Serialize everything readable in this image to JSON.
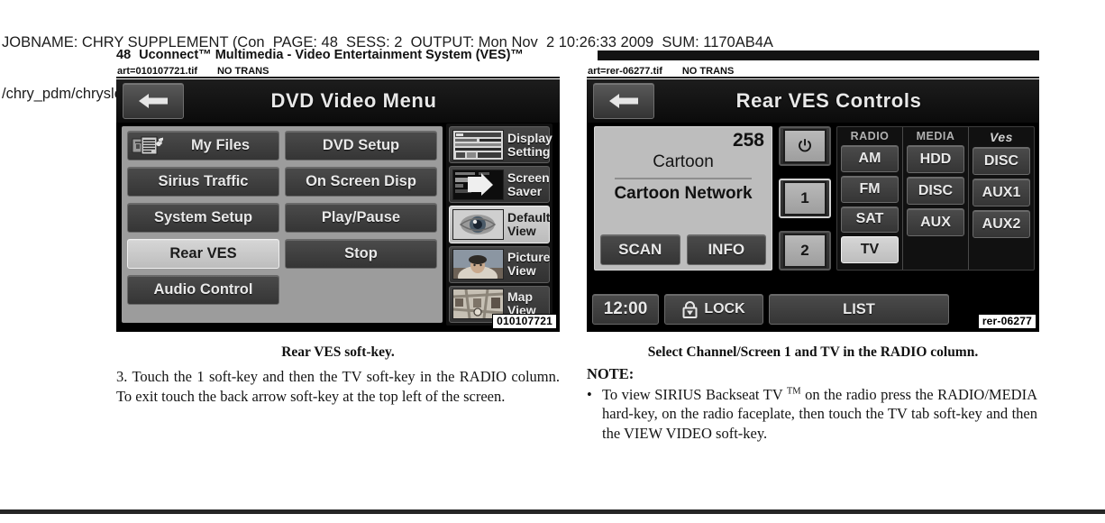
{
  "job_header": {
    "line1": "JOBNAME: CHRY SUPPLEMENT (Con  PAGE: 48  SESS: 2  OUTPUT: Mon Nov  2 10:26:33 2009  SUM: 1170AB4A",
    "line2": "/chry_pdm/chrysler/supplement/uct/su"
  },
  "running_head": {
    "page_number": "48",
    "title": "Uconnect™ Multimedia - Video Entertainment System (VES)™"
  },
  "art_tags": {
    "left": {
      "file": "art=010107721.tif",
      "trans": "NO TRANS"
    },
    "right": {
      "file": "art=rer-06277.tif",
      "trans": "NO TRANS"
    }
  },
  "figures": {
    "left": {
      "art_id": "010107721",
      "caption": "Rear VES soft-key.",
      "screen": {
        "title": "DVD Video Menu",
        "back_icon": "back-arrow-icon",
        "left_column": [
          {
            "label": "My Files",
            "icon": "media-files-icon",
            "selected": false
          },
          {
            "label": "Sirius Traffic",
            "selected": false
          },
          {
            "label": "System Setup",
            "selected": false
          },
          {
            "label": "Rear  VES",
            "selected": true
          },
          {
            "label": "Audio Control",
            "selected": false
          }
        ],
        "right_column": [
          {
            "label": "DVD Setup",
            "selected": false
          },
          {
            "label": "On  Screen  Disp",
            "selected": false
          },
          {
            "label": "Play/Pause",
            "selected": false
          },
          {
            "label": "Stop",
            "selected": false
          },
          {
            "label": "",
            "selected": false,
            "blank": true
          }
        ],
        "view_column": [
          {
            "label": "Display\nSetting",
            "icon": "display-setting-thumb",
            "selected": false
          },
          {
            "label": "Screen\nSaver",
            "icon": "screen-saver-thumb",
            "selected": false
          },
          {
            "label": "Default\nView",
            "icon": "default-view-thumb",
            "selected": true
          },
          {
            "label": "Picture\nView",
            "icon": "picture-view-thumb",
            "selected": false
          },
          {
            "label": "Map\nView",
            "icon": "map-view-thumb",
            "selected": false
          }
        ]
      }
    },
    "right": {
      "art_id": "rer-06277",
      "caption": "Select Channel/Screen 1 and TV in the RADIO column.",
      "screen": {
        "title": "Rear VES Controls",
        "back_icon": "back-arrow-icon",
        "info": {
          "channel_number": "258",
          "channel_name": "Cartoon",
          "channel_detail": "Cartoon Network",
          "scan_label": "SCAN",
          "info_label": "INFO"
        },
        "screen_select": [
          {
            "label": "⏻",
            "name": "power-button",
            "selected": false
          },
          {
            "label": "1",
            "name": "screen-1-button",
            "selected": true
          },
          {
            "label": "2",
            "name": "screen-2-button",
            "selected": false
          }
        ],
        "source_columns": [
          {
            "header": "RADIO",
            "buttons": [
              {
                "label": "AM",
                "selected": false
              },
              {
                "label": "FM",
                "selected": false
              },
              {
                "label": "SAT",
                "selected": false
              },
              {
                "label": "TV",
                "selected": true
              }
            ]
          },
          {
            "header": "MEDIA",
            "buttons": [
              {
                "label": "HDD",
                "selected": false
              },
              {
                "label": "DISC",
                "selected": false
              },
              {
                "label": "AUX",
                "selected": false
              }
            ]
          },
          {
            "header": "Ves",
            "buttons": [
              {
                "label": "DISC",
                "selected": false
              },
              {
                "label": "AUX1",
                "selected": false
              },
              {
                "label": "AUX2",
                "selected": false
              }
            ]
          }
        ],
        "bottom_bar": {
          "clock": "12:00",
          "lock_label": "LOCK",
          "lock_icon": "lock-icon",
          "list_label": "LIST"
        }
      }
    }
  },
  "body": {
    "left_paragraph": "3. Touch the 1 soft-key and then the TV soft-key in the RADIO column. To exit touch the back arrow soft-key at the top left of the screen.",
    "right_note_heading": "NOTE:",
    "right_bullet_dot": "•",
    "right_bullet_part1": "To view SIRIUS Backseat TV ",
    "right_bullet_tm": "TM",
    "right_bullet_part2": " on the radio press the RADIO/MEDIA hard-key, on the radio faceplate, then touch the TV tab soft-key and then the VIEW VIDEO soft-key."
  },
  "colors": {
    "page_bg": "#ffffff",
    "ink": "#141414",
    "screen_bg": "#000000",
    "button_face": "#3f3f3f",
    "button_selected": "#c9c9c9",
    "panel_gray": "#9c9c9c",
    "info_panel": "#bdbdbd"
  }
}
